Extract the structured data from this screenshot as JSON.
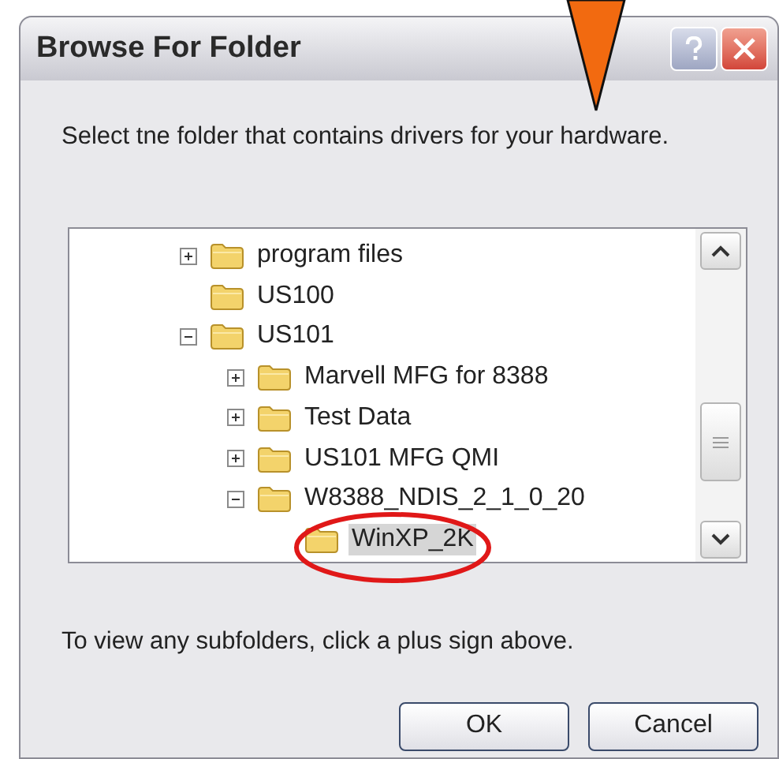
{
  "window": {
    "title": "Browse For Folder"
  },
  "description": "Select tne folder that contains drivers for your hardware.",
  "tree": [
    {
      "label": "program files",
      "kind": "branch",
      "expanded": false,
      "selected": false
    },
    {
      "label": "US100",
      "kind": "leaf",
      "selected": false
    },
    {
      "label": "US101",
      "kind": "branch",
      "expanded": true,
      "selected": false,
      "children": [
        {
          "label": "Marvell MFG for 8388",
          "kind": "branch",
          "expanded": false,
          "selected": false
        },
        {
          "label": "Test Data",
          "kind": "branch",
          "expanded": false,
          "selected": false
        },
        {
          "label": "US101 MFG QMI",
          "kind": "branch",
          "expanded": false,
          "selected": false
        },
        {
          "label": "W8388_NDIS_2_1_0_20",
          "kind": "branch",
          "expanded": true,
          "selected": false,
          "children": [
            {
              "label": "WinXP_2K",
              "kind": "leaf",
              "selected": true
            }
          ]
        }
      ]
    }
  ],
  "hint": "To view any subfolders, click a plus sign above.",
  "buttons": [
    "OK",
    "Cancel"
  ]
}
